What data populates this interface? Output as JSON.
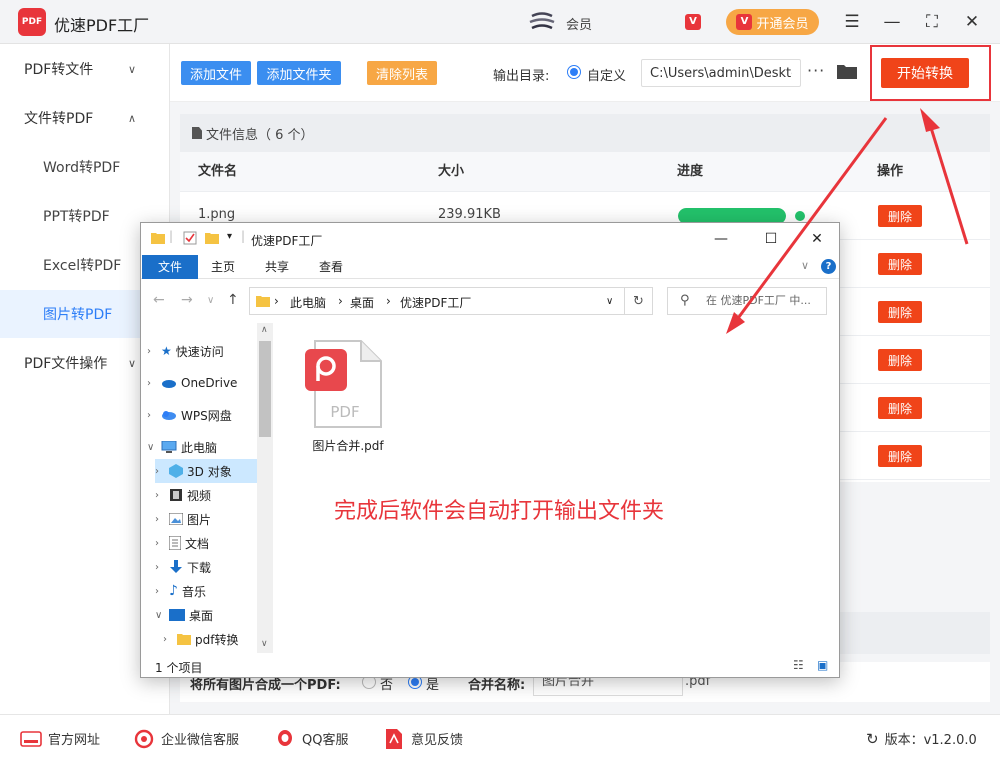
{
  "app": {
    "title": "优速PDF工厂",
    "logo_text": "PDF",
    "user_name": "会员",
    "vip_label": "开通会员",
    "vip_badge": "V"
  },
  "sidebar": {
    "items": [
      {
        "label": "PDF转文件",
        "chevron": "∨"
      },
      {
        "label": "文件转PDF",
        "chevron": "∧"
      },
      {
        "label": "Word转PDF"
      },
      {
        "label": "PPT转PDF"
      },
      {
        "label": "Excel转PDF"
      },
      {
        "label": "图片转PDF"
      },
      {
        "label": "PDF文件操作",
        "chevron": "∨"
      }
    ]
  },
  "toolbar": {
    "add_file": "添加文件",
    "add_folder": "添加文件夹",
    "clear_list": "清除列表",
    "output_label": "输出目录:",
    "custom_label": "自定义",
    "path_value": "C:\\Users\\admin\\Desktop",
    "more": "···",
    "start": "开始转换"
  },
  "main": {
    "file_info": "文件信息（ 6 个）",
    "columns": {
      "name": "文件名",
      "size": "大小",
      "progress": "进度",
      "action": "操作"
    },
    "rows": [
      {
        "name": "1.png",
        "size": "239.91KB",
        "progress": 1.0,
        "delete": "删除"
      },
      {
        "delete": "删除"
      },
      {
        "delete": "删除"
      },
      {
        "delete": "删除"
      },
      {
        "delete": "删除"
      },
      {
        "delete": "删除"
      }
    ],
    "merge_label": "将所有图片合成一个PDF:",
    "merge_no": "否",
    "merge_yes": "是",
    "merge_name_label": "合并名称:",
    "merge_name_value": "图片合并",
    "merge_ext": ".pdf"
  },
  "footer": {
    "website": "官方网址",
    "wechat": "企业微信客服",
    "qq": "QQ客服",
    "feedback": "意见反馈",
    "version": "版本：v1.2.0.0"
  },
  "explorer": {
    "title": "优速PDF工厂",
    "tabs": [
      "文件",
      "主页",
      "共享",
      "查看"
    ],
    "address": [
      "此电脑",
      "桌面",
      "优速PDF工厂"
    ],
    "search_placeholder": "在 优速PDF工厂 中...",
    "nav": [
      {
        "label": "快速访问"
      },
      {
        "label": "OneDrive"
      },
      {
        "label": "WPS网盘"
      },
      {
        "label": "此电脑"
      },
      {
        "label": "3D 对象"
      },
      {
        "label": "视频"
      },
      {
        "label": "图片"
      },
      {
        "label": "文档"
      },
      {
        "label": "下载"
      },
      {
        "label": "音乐"
      },
      {
        "label": "桌面"
      },
      {
        "label": "pdf转换"
      }
    ],
    "file_name": "图片合并.pdf",
    "pdf_badge": "PDF",
    "status": "1 个项目"
  },
  "annotation": {
    "message": "完成后软件会自动打开输出文件夹",
    "color": "#e8353b"
  },
  "colors": {
    "accent_blue": "#3b8ef0",
    "accent_orange": "#f7a745",
    "danger": "#f04419",
    "success": "#23c26b"
  }
}
